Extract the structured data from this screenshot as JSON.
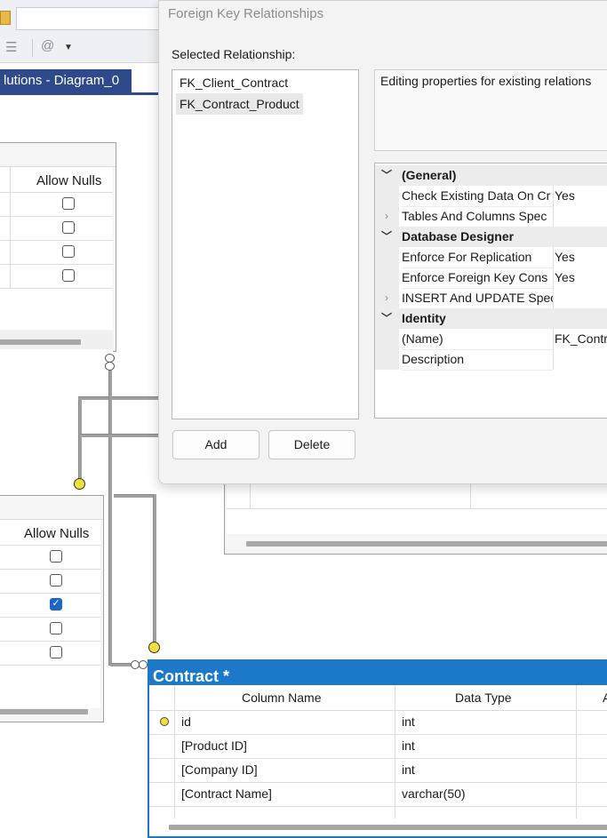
{
  "background": {
    "doc_tab_title": "lutions - Diagram_0",
    "left_table_top": {
      "header_allow_nulls": "Allow Nulls",
      "null_checks": [
        false,
        false,
        false,
        false
      ]
    },
    "left_table_bottom": {
      "header_allow_nulls": "Allow Nulls",
      "null_checks": [
        false,
        false,
        true,
        false,
        false
      ]
    }
  },
  "dialog": {
    "title": "Foreign Key Relationships",
    "selected_label": "Selected Relationship:",
    "relationships": [
      {
        "label": "FK_Client_Contract",
        "selected": false
      },
      {
        "label": "FK_Contract_Product",
        "selected": true
      }
    ],
    "add_label": "Add",
    "delete_label": "Delete",
    "info_text": "Editing properties for existing relations",
    "properties": [
      {
        "type": "category",
        "label": "(General)"
      },
      {
        "type": "item",
        "label": "Check Existing Data On Cr",
        "value": "Yes"
      },
      {
        "type": "item",
        "label": "Tables And Columns Spec",
        "value": "",
        "expandable": true
      },
      {
        "type": "category",
        "label": "Database Designer"
      },
      {
        "type": "item",
        "label": "Enforce For Replication",
        "value": "Yes"
      },
      {
        "type": "item",
        "label": "Enforce Foreign Key Cons",
        "value": "Yes"
      },
      {
        "type": "item",
        "label": "INSERT And UPDATE Spec",
        "value": "",
        "expandable": true
      },
      {
        "type": "category",
        "label": "Identity"
      },
      {
        "type": "item",
        "label": "(Name)",
        "value": "FK_Contr"
      },
      {
        "type": "item",
        "label": "Description",
        "value": ""
      }
    ]
  },
  "contract_table": {
    "title": "Contract *",
    "headers": {
      "column_name": "Column Name",
      "data_type": "Data Type",
      "allow_nulls_partial": "A"
    },
    "rows": [
      {
        "name": "id",
        "type": "int",
        "primary_key": true
      },
      {
        "name": "[Product ID]",
        "type": "int"
      },
      {
        "name": "[Company ID]",
        "type": "int"
      },
      {
        "name": "[Contract Name]",
        "type": "varchar(50)"
      }
    ]
  }
}
